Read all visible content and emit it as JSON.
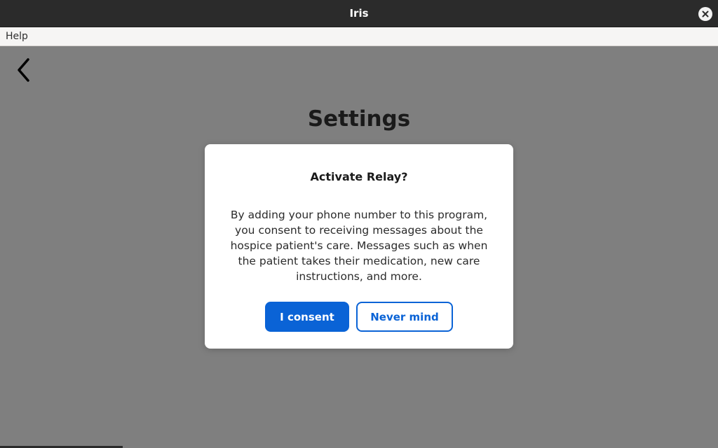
{
  "window": {
    "title": "Iris",
    "close_icon": "close-icon"
  },
  "menubar": {
    "items": [
      {
        "label": "Help"
      }
    ]
  },
  "page": {
    "back_icon": "chevron-left-icon",
    "title": "Settings"
  },
  "dialog": {
    "title": "Activate Relay?",
    "body": "By adding your phone number to this program, you consent to receiving messages about the hospice patient's care. Messages such as when the patient takes their medication, new care instructions, and more.",
    "consent_label": "I consent",
    "cancel_label": "Never mind"
  },
  "colors": {
    "accent": "#0a63d6",
    "overlay": "#7f7f7f",
    "titlebar": "#2b2b2b",
    "menubar": "#f6f5f4"
  }
}
